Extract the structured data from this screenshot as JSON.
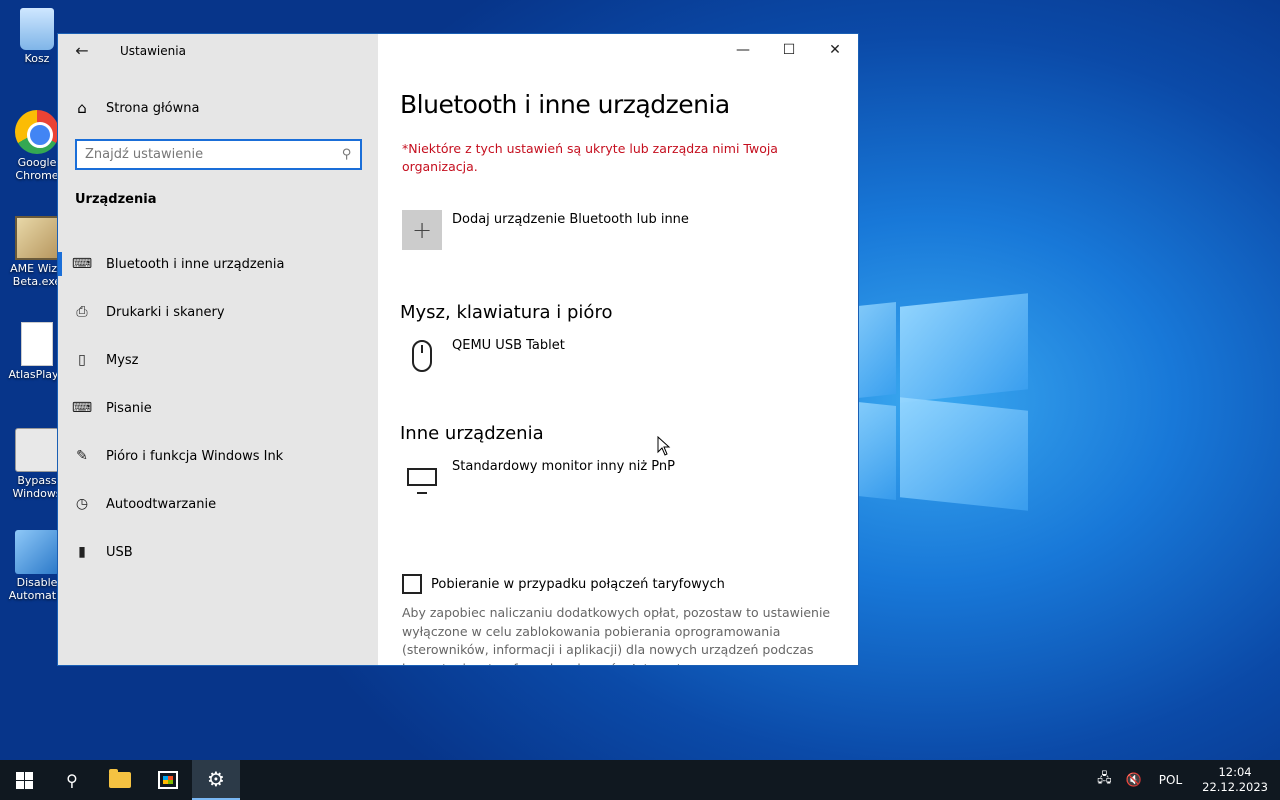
{
  "desktop": {
    "icons": [
      {
        "label": "Kosz",
        "icon": "recycle-bin-icon"
      },
      {
        "label": "Google Chrome",
        "icon": "chrome-icon"
      },
      {
        "label": "AME Wiza Beta.exe",
        "icon": "ame-wizard-icon"
      },
      {
        "label": "AtlasPlayb",
        "icon": "document-icon"
      },
      {
        "label": "Bypass Windows",
        "icon": "settings-file-icon"
      },
      {
        "label": "Disable Automatic",
        "icon": "cubes-icon"
      }
    ]
  },
  "window": {
    "title": "Ustawienia",
    "sidebar": {
      "home_label": "Strona główna",
      "search_placeholder": "Znajdź ustawienie",
      "section_label": "Urządzenia",
      "items": [
        {
          "label": "Bluetooth i inne urządzenia",
          "icon": "bluetooth-devices-icon",
          "active": true
        },
        {
          "label": "Drukarki i skanery",
          "icon": "printer-icon",
          "active": false
        },
        {
          "label": "Mysz",
          "icon": "mouse-icon",
          "active": false
        },
        {
          "label": "Pisanie",
          "icon": "keyboard-icon",
          "active": false
        },
        {
          "label": "Pióro i funkcja Windows Ink",
          "icon": "pen-icon",
          "active": false
        },
        {
          "label": "Autoodtwarzanie",
          "icon": "autoplay-icon",
          "active": false
        },
        {
          "label": "USB",
          "icon": "usb-icon",
          "active": false
        }
      ]
    },
    "content": {
      "title": "Bluetooth i inne urządzenia",
      "warning": "*Niektóre z tych ustawień są ukryte lub zarządza nimi Twoja organizacja.",
      "add_device_label": "Dodaj urządzenie Bluetooth lub inne",
      "categories": [
        {
          "title": "Mysz, klawiatura i pióro",
          "devices": [
            {
              "name": "QEMU USB Tablet",
              "icon": "mouse-icon"
            }
          ]
        },
        {
          "title": "Inne urządzenia",
          "devices": [
            {
              "name": "Standardowy monitor inny niż PnP",
              "icon": "monitor-icon"
            }
          ]
        }
      ],
      "metered_label": "Pobieranie w przypadku połączeń taryfowych",
      "metered_checked": false,
      "metered_description": "Aby zapobiec naliczaniu dodatkowych opłat, pozostaw to ustawienie wyłączone w celu zablokowania pobierania oprogramowania (sterowników, informacji i aplikacji) dla nowych urządzeń podczas korzystania z taryfowych połączeń z Internetem."
    }
  },
  "taskbar": {
    "language": "POL",
    "time": "12:04",
    "date": "22.12.2023"
  },
  "colors": {
    "accent": "#1a6ed8",
    "warning": "#c50f1f",
    "sidebar_bg": "#e6e6e6",
    "taskbar_bg": "#101820"
  }
}
